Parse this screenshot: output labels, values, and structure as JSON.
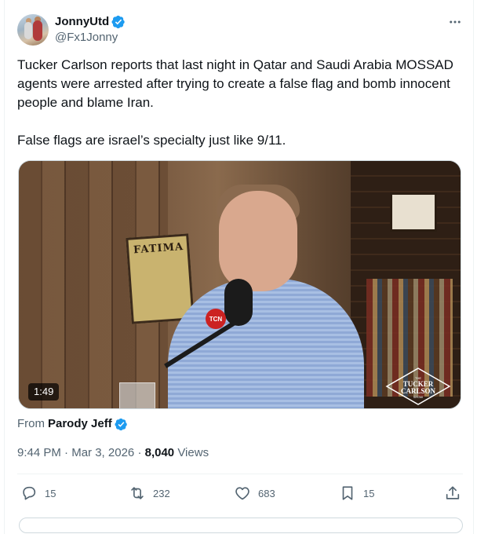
{
  "tweet": {
    "author": {
      "display_name": "JonnyUtd",
      "handle": "@Fx1Jonny",
      "verified": true
    },
    "text": "Tucker Carlson reports that last night in Qatar and Saudi Arabia MOSSAD agents were arrested after trying to create a false flag and bomb innocent people and blame Iran.\n\nFalse flags are israel’s specialty just like 9/11.",
    "media": {
      "duration": "1:49",
      "poster_text": "FATIMA",
      "mic_badge": "TCN",
      "show_logo_lines": [
        "THE",
        "TUCKER",
        "CARLSON",
        "SHOW"
      ]
    },
    "from": {
      "prefix": "From",
      "name": "Parody Jeff",
      "verified": true
    },
    "time": "9:44 PM",
    "date": "Mar 3, 2026",
    "separator": "·",
    "views_count": "8,040",
    "views_label": "Views",
    "actions": {
      "replies": "15",
      "reposts": "232",
      "likes": "683",
      "bookmarks": "15"
    }
  },
  "icons": {
    "verified": "verified-badge-icon",
    "more": "more-horizontal-icon",
    "reply": "reply-icon",
    "repost": "repost-icon",
    "like": "heart-icon",
    "bookmark": "bookmark-icon",
    "share": "share-icon"
  },
  "colors": {
    "verified_blue": "#1d9bf0",
    "secondary_text": "#536471",
    "primary_text": "#0f1419"
  }
}
